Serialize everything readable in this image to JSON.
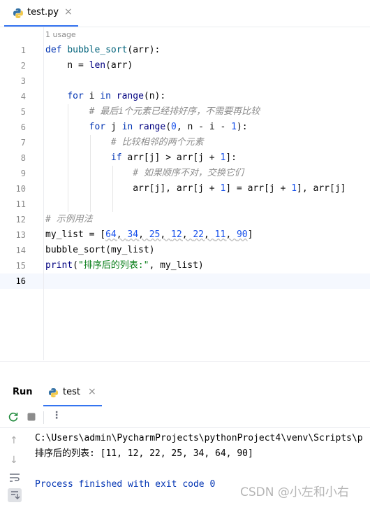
{
  "tab": {
    "filename": "test.py",
    "close": "×"
  },
  "editor": {
    "usage": "1 usage",
    "line_numbers": [
      "1",
      "2",
      "3",
      "4",
      "5",
      "6",
      "7",
      "8",
      "9",
      "10",
      "11",
      "12",
      "13",
      "14",
      "15",
      "16"
    ],
    "code": {
      "l1": {
        "kw": "def",
        "fn": "bubble_sort",
        "rest": "(arr):"
      },
      "l2": {
        "a": "    n = ",
        "bi": "len",
        "b": "(arr)"
      },
      "l4": {
        "a": "    ",
        "kw1": "for",
        "b": " i ",
        "kw2": "in",
        "c": " ",
        "bi": "range",
        "d": "(n):"
      },
      "l5": {
        "a": "        ",
        "cm": "# 最后i个元素已经排好序，不需要再比较"
      },
      "l6": {
        "a": "        ",
        "kw1": "for",
        "b": " j ",
        "kw2": "in",
        "c": " ",
        "bi": "range",
        "d": "(",
        "n1": "0",
        "e": ", n - i - ",
        "n2": "1",
        "f": "):"
      },
      "l7": {
        "a": "            ",
        "cm": "# 比较相邻的两个元素"
      },
      "l8": {
        "a": "            ",
        "kw": "if",
        "b": " arr[j] > arr[j + ",
        "n1": "1",
        "c": "]:"
      },
      "l9": {
        "a": "                ",
        "cm": "# 如果顺序不对，交换它们"
      },
      "l10": {
        "a": "                arr[j], arr[j + ",
        "n1": "1",
        "b": "] = arr[j + ",
        "n2": "1",
        "c": "], arr[j]"
      },
      "l12": {
        "cm": "# 示例用法"
      },
      "l13": {
        "a": "my_list = [",
        "v1": "64",
        "s1": ", ",
        "v2": "34",
        "s2": ", ",
        "v3": "25",
        "s3": ", ",
        "v4": "12",
        "s4": ", ",
        "v5": "22",
        "s5": ", ",
        "v6": "11",
        "s6": ", ",
        "v7": "90",
        "b": "]"
      },
      "l14": {
        "text": "bubble_sort(my_list)"
      },
      "l15": {
        "bi": "print",
        "a": "(",
        "str": "\"排序后的列表:\"",
        "b": ", my_list)"
      }
    }
  },
  "panel": {
    "run_label": "Run",
    "run_tab": "test",
    "close": "×",
    "console": {
      "path": "C:\\Users\\admin\\PycharmProjects\\pythonProject4\\venv\\Scripts\\p",
      "output": "排序后的列表: [11, 12, 22, 25, 34, 64, 90]",
      "finished": "Process finished with exit code 0"
    },
    "watermark": "CSDN @小左和小右"
  },
  "colors": {
    "accent": "#3574f0",
    "keyword": "#0033b3",
    "function": "#00627a",
    "number": "#1750eb",
    "string": "#067d17",
    "comment": "#8c8c8c",
    "console_blue": "#0033b3",
    "current_line": "#f5f8fe"
  },
  "icons": [
    "python-file-icon",
    "rerun-icon",
    "stop-icon",
    "more-options-icon",
    "scroll-up-icon",
    "scroll-down-icon",
    "soft-wrap-icon",
    "scroll-to-end-icon"
  ]
}
